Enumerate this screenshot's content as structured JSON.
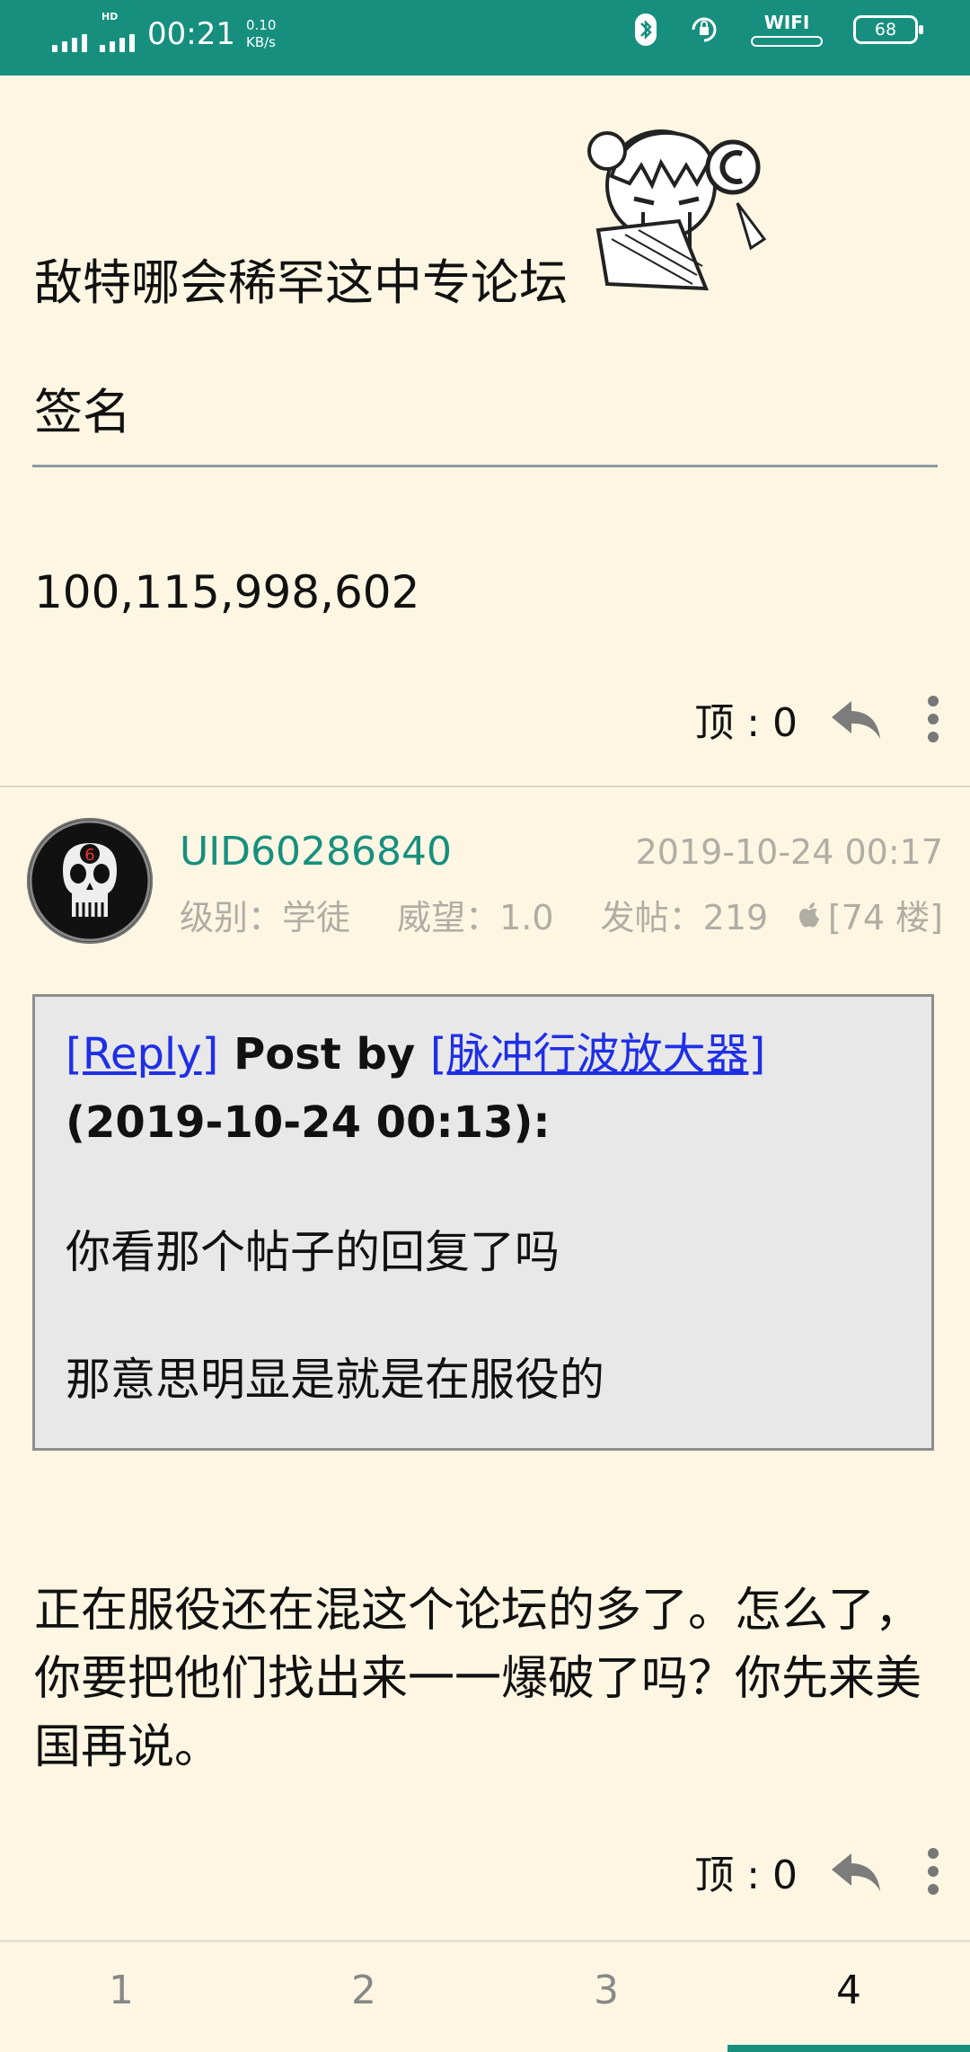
{
  "status_bar": {
    "time": "00:21",
    "hd_label": "HD",
    "speed_value": "0.10",
    "speed_unit": "KB/s",
    "wifi_label": "WIFI",
    "battery": "68"
  },
  "post1": {
    "text_line": "敌特哪会稀罕这中专论坛",
    "signature_label": "签名",
    "number": "100,115,998,602",
    "top_label": "顶 : 0"
  },
  "post2": {
    "username": "UID60286840",
    "date": "2019-10-24 00:17",
    "level": "级别：学徒",
    "prestige": "威望：1.0",
    "posts": "发帖：219",
    "floor": "[74 楼]",
    "quote": {
      "reply_link": "[Reply]",
      "post_by": "Post by",
      "author_link": "[脉冲行波放大器]",
      "timestamp": "(2019-10-24 00:13):",
      "line1": "你看那个帖子的回复了吗",
      "line2": "那意思明显是就是在服役的"
    },
    "body": "正在服役还在混这个论坛的多了。怎么了，你要把他们找出来一一爆破了吗？你先来美国再说。",
    "top_label": "顶 : 0"
  },
  "pagination": {
    "pages": [
      "1",
      "2",
      "3",
      "4"
    ],
    "active_page": "4"
  },
  "colors": {
    "accent": "#178F7E",
    "background": "#FDF6E3",
    "link": "#1F2FE6"
  }
}
